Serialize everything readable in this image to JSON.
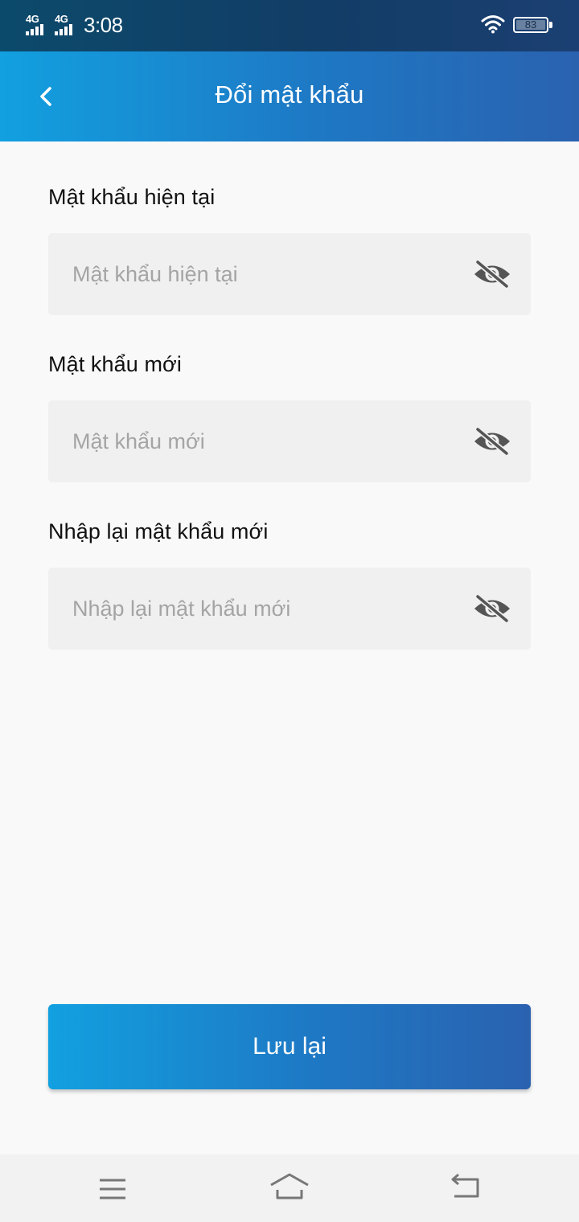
{
  "status_bar": {
    "network_1": "4G",
    "network_2": "4G",
    "time": "3:08",
    "battery": "83",
    "icons": [
      "signal-icon",
      "wifi-icon",
      "battery-icon"
    ]
  },
  "header": {
    "title": "Đổi mật khẩu",
    "back_icon": "chevron-left-icon"
  },
  "form": {
    "current_password": {
      "label": "Mật khẩu hiện tại",
      "placeholder": "Mật khẩu hiện tại",
      "value": ""
    },
    "new_password": {
      "label": "Mật khẩu mới",
      "placeholder": "Mật khẩu mới",
      "value": ""
    },
    "confirm_password": {
      "label": "Nhập lại mật khẩu mới",
      "placeholder": "Nhập lại mật khẩu mới",
      "value": ""
    },
    "toggle_icon": "eye-off-icon"
  },
  "save_button": {
    "label": "Lưu lại"
  },
  "nav_bar": {
    "icons": [
      "menu-icon",
      "home-icon",
      "back-arrow-icon"
    ]
  },
  "colors": {
    "header_gradient_start": "#12a0e0",
    "header_gradient_end": "#2a62b0",
    "status_bar": "#123d66",
    "field_background": "#f0f0f0",
    "placeholder_text": "#a4a4a4",
    "icon_gray": "#555555"
  }
}
